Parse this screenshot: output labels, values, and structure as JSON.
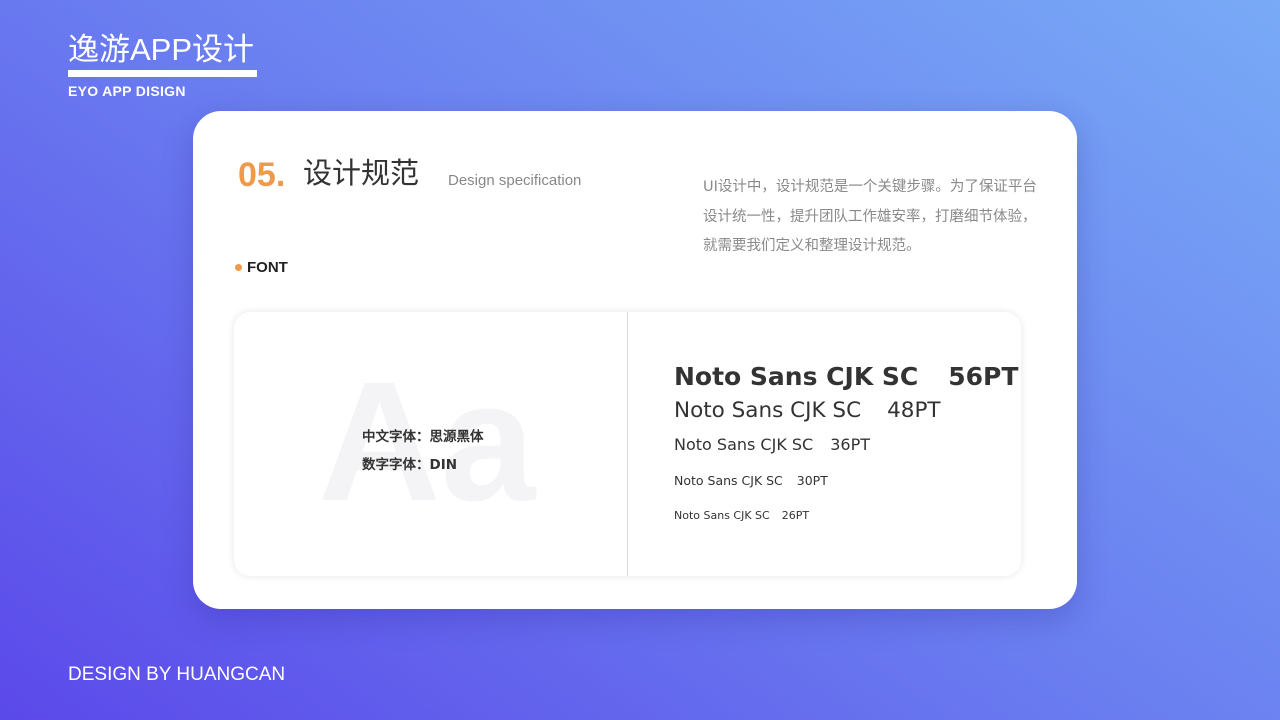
{
  "brand": {
    "title": "逸游APP设计",
    "subtitle": "EYO APP DISIGN"
  },
  "footer": "DESIGN BY HUANGCAN",
  "section": {
    "number": "05.",
    "title": "设计规范",
    "subtitle": "Design specification",
    "description": "UI设计中，设计规范是一个关键步骤。为了保证平台设计统一性，提升团队工作雄安率，打磨细节体验，就需要我们定义和整理设计规范。"
  },
  "font_label": "FONT",
  "sample_glyph": "Aa",
  "font_info": {
    "chinese": "中文字体：思源黑体",
    "digits": "数字字体：DIN"
  },
  "font_specs": [
    {
      "name": "Noto Sans CJK SC",
      "size": "56PT"
    },
    {
      "name": "Noto Sans CJK SC",
      "size": "48PT"
    },
    {
      "name": "Noto Sans CJK SC",
      "size": "36PT"
    },
    {
      "name": "Noto Sans CJK SC",
      "size": "30PT"
    },
    {
      "name": "Noto Sans CJK SC",
      "size": "26PT"
    }
  ],
  "colors": {
    "accent": "#ef9a4b",
    "gradient_start": "#5b49ea",
    "gradient_end": "#78aaf6"
  }
}
